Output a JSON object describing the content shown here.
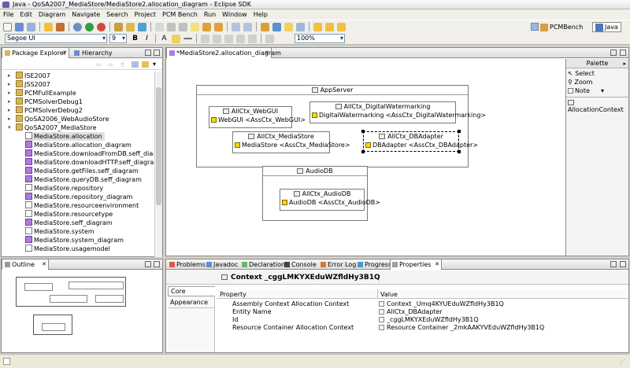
{
  "window": {
    "title": "Java - QoSA2007_MediaStore/MediaStore2.allocation_diagram - Eclipse SDK"
  },
  "menu": [
    "File",
    "Edit",
    "Diagram",
    "Navigate",
    "Search",
    "Project",
    "PCM Bench",
    "Run",
    "Window",
    "Help"
  ],
  "toolbar2": {
    "font_family": "Segoe UI",
    "font_size": "9",
    "zoom": "100%"
  },
  "perspectives": [
    {
      "label": "PCMBench"
    },
    {
      "label": "Java"
    }
  ],
  "package_explorer": {
    "tabs": [
      "Package Explorer",
      "Hierarchy"
    ],
    "items": [
      {
        "label": "ISE2007",
        "kind": "project"
      },
      {
        "label": "JSS2007",
        "kind": "project"
      },
      {
        "label": "PCMFullExample",
        "kind": "project"
      },
      {
        "label": "PCMSolverDebug1",
        "kind": "project"
      },
      {
        "label": "PCMSolverDebug2",
        "kind": "project"
      },
      {
        "label": "QoSA2006_WebAudioStore",
        "kind": "project"
      },
      {
        "label": "QoSA2007_MediaStore",
        "kind": "project"
      },
      {
        "label": "MediaStore.allocation",
        "kind": "file"
      },
      {
        "label": "MediaStore.allocation_diagram",
        "kind": "diagram"
      },
      {
        "label": "MediaStore.downloadFromDB.seff_diagram",
        "kind": "diagram"
      },
      {
        "label": "MediaStore.downloadHTTP.seff_diagram",
        "kind": "diagram"
      },
      {
        "label": "MediaStore.getFiles.seff_diagram",
        "kind": "diagram"
      },
      {
        "label": "MediaStore.queryDB.seff_diagram",
        "kind": "diagram"
      },
      {
        "label": "MediaStore.repository",
        "kind": "file"
      },
      {
        "label": "MediaStore.repository_diagram",
        "kind": "diagram"
      },
      {
        "label": "MediaStore.resourceenvironment",
        "kind": "file"
      },
      {
        "label": "MediaStore.resourcetype",
        "kind": "file"
      },
      {
        "label": "MediaStore.seff_diagram",
        "kind": "diagram"
      },
      {
        "label": "MediaStore.system",
        "kind": "file"
      },
      {
        "label": "MediaStore.system_diagram",
        "kind": "diagram"
      },
      {
        "label": "MediaStore.usagemodel",
        "kind": "file"
      }
    ]
  },
  "outline": {
    "tab": "Outline"
  },
  "editor": {
    "tab": "*MediaStore2.allocation_diagram",
    "containers": [
      {
        "title": "AppServer"
      },
      {
        "title": "AudioDB"
      }
    ],
    "contexts": [
      {
        "title": "AllCtx_WebGUI",
        "body": "WebGUI <AssCtx_WebGUI>"
      },
      {
        "title": "AllCtx_DigitalWatermarking",
        "body": "DigitalWatermarking <AssCtx_DigitalWatermarking>"
      },
      {
        "title": "AllCtx_MediaStore",
        "body": "MediaStore <AssCtx_MediaStore>"
      },
      {
        "title": "AllCtx_DBAdapter",
        "body": "DBAdapter <AssCtx_DBAdapter>"
      },
      {
        "title": "AllCtx_AudioDB",
        "body": "AudioDB <AssCtx_AudioDB>"
      }
    ]
  },
  "palette": {
    "title": "Palette",
    "tools": [
      "Select",
      "Zoom",
      "Note"
    ],
    "drawer": "AllocationContext"
  },
  "bottom_tabs": [
    "Problems",
    "Javadoc",
    "Declaration",
    "Console",
    "Error Log",
    "Progress",
    "Properties"
  ],
  "properties": {
    "title": "Context _cggLMKYXEduWZfldHy3B1Q",
    "side_tabs": [
      "Core",
      "Appearance"
    ],
    "col_property": "Property",
    "col_value": "Value",
    "rows": [
      {
        "property": "Assembly Context Allocation Context",
        "value": "Context _Umq4KYUEduWZfldHy3B1Q"
      },
      {
        "property": "Entity Name",
        "value": "AllCtx_DBAdapter"
      },
      {
        "property": "Id",
        "value": "_cggLMKYXEduWZfldHy3B1Q"
      },
      {
        "property": "Resource Container Allocation Context",
        "value": "Resource Container _2mkAAKYVEduWZfldHy3B1Q"
      }
    ]
  }
}
